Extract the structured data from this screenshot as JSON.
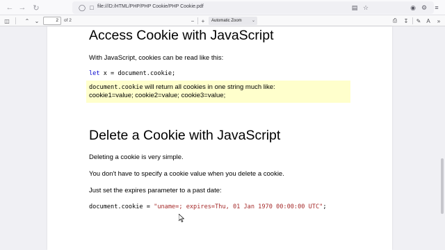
{
  "browser": {
    "url": "file:///D:/HTML/PHP/PHP Cookie/PHP Cookie.pdf"
  },
  "pdf_toolbar": {
    "page_number": "2",
    "page_count": "of 2",
    "zoom": "Automatic Zoom"
  },
  "document": {
    "section1": {
      "heading": "Access Cookie with JavaScript",
      "intro": "With JavaScript, cookies can be read like this:",
      "code_keyword": "let",
      "code_rest": " x = document.cookie;",
      "note_code": "document.cookie",
      "note_line1_rest": " will return all cookies in one string much like:",
      "note_line2": "cookie1=value; cookie2=value; cookie3=value;"
    },
    "section2": {
      "heading": "Delete a Cookie with JavaScript",
      "p1": "Deleting a cookie is very simple.",
      "p2": "You don't have to specify a cookie value when you delete a cookie.",
      "p3": "Just set the expires parameter to a past date:",
      "code_prefix": "document.cookie = ",
      "code_string": "\"uname=; expires=Thu, 01 Jan 1970 00:00:00 UTC\"",
      "code_suffix": ";"
    }
  },
  "colors": {
    "note_background": "#ffffcc",
    "keyword": "#0000cd",
    "string": "#a52a2a"
  }
}
